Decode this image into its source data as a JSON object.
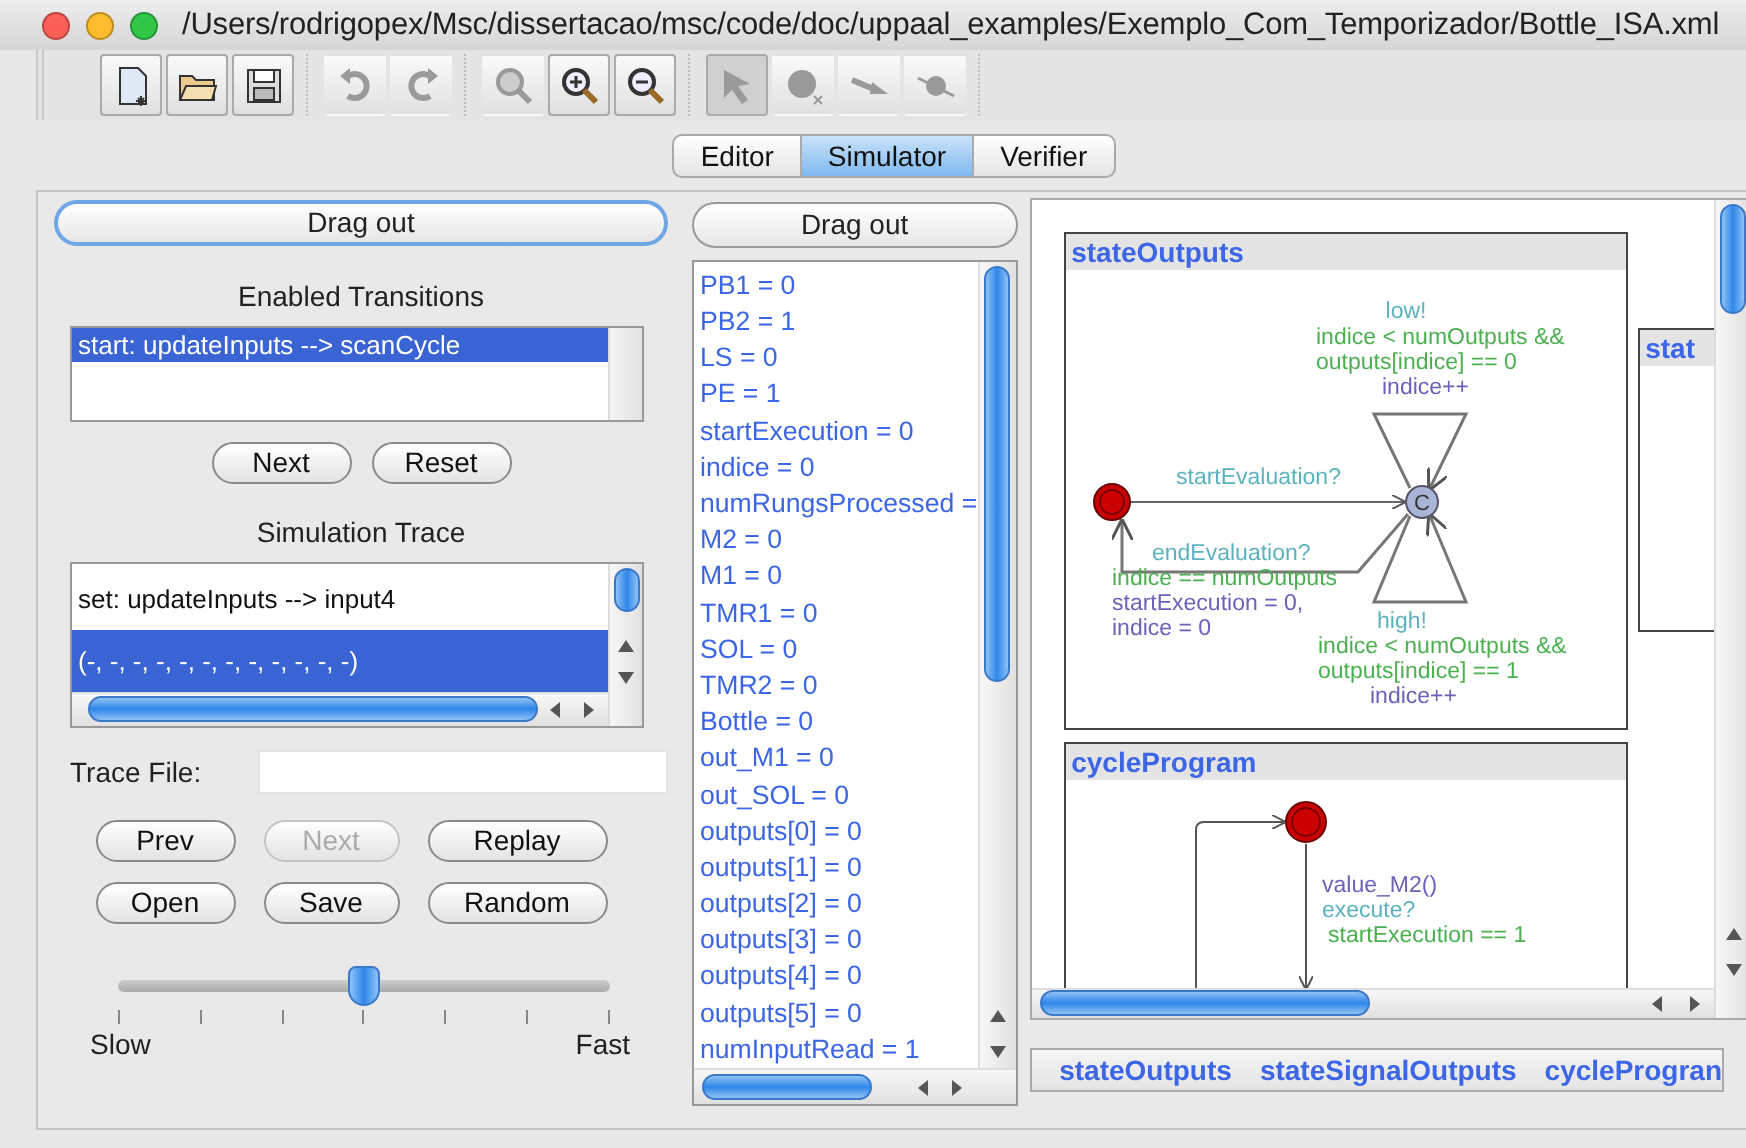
{
  "window": {
    "title": "/Users/rodrigopex/Msc/dissertacao/msc/code/doc/uppaal_examples/Exemplo_Com_Temporizador/Bottle_ISA.xml"
  },
  "toolbar": [
    [
      {
        "kind": "new",
        "disabled": false,
        "selected": false
      },
      {
        "kind": "open",
        "disabled": false,
        "selected": false
      },
      {
        "kind": "save",
        "disabled": false,
        "selected": false
      }
    ],
    [
      {
        "kind": "undo",
        "disabled": true,
        "selected": false
      },
      {
        "kind": "redo",
        "disabled": true,
        "selected": false
      }
    ],
    [
      {
        "kind": "zoom-fit",
        "disabled": true,
        "selected": false
      },
      {
        "kind": "zoom-in",
        "disabled": false,
        "selected": false
      },
      {
        "kind": "zoom-out",
        "disabled": false,
        "selected": false
      }
    ],
    [
      {
        "kind": "select",
        "disabled": true,
        "selected": true
      },
      {
        "kind": "location",
        "disabled": true,
        "selected": false
      },
      {
        "kind": "edge",
        "disabled": true,
        "selected": false
      },
      {
        "kind": "nail",
        "disabled": true,
        "selected": false
      }
    ]
  ],
  "tabs": [
    {
      "label": "Editor",
      "selected": false
    },
    {
      "label": "Simulator",
      "selected": true
    },
    {
      "label": "Verifier",
      "selected": false
    }
  ],
  "simulation": {
    "drag_out": "Drag out",
    "enabled_transitions": {
      "title": "Enabled Transitions",
      "items": [
        {
          "text": "start: updateInputs --> scanCycle",
          "selected": true
        }
      ]
    },
    "transition_buttons": [
      "Next",
      "Reset"
    ],
    "trace": {
      "title": "Simulation Trace",
      "items": [
        {
          "text": "set: updateInputs --> input4",
          "selected": false
        },
        {
          "text": "(-, -, -, -, -, -, -, -, -, -, -, -)",
          "selected": true
        }
      ]
    },
    "trace_file": {
      "label": "Trace File:"
    },
    "trace_buttons": [
      {
        "label": "Prev",
        "disabled": false
      },
      {
        "label": "Next",
        "disabled": true
      },
      {
        "label": "Replay",
        "disabled": false
      },
      {
        "label": "Open",
        "disabled": false
      },
      {
        "label": "Save",
        "disabled": false
      },
      {
        "label": "Random",
        "disabled": false
      }
    ],
    "speed": {
      "level": 0.5,
      "min_label": "Slow",
      "max_label": "Fast"
    }
  },
  "variables": {
    "drag_out": "Drag out",
    "items": [
      "PB1 = 0",
      "PB2 = 1",
      "LS = 0",
      "PE = 1",
      "startExecution = 0",
      "indice = 0",
      "numRungsProcessed =",
      "M2 = 0",
      "M1 = 0",
      "TMR1 = 0",
      "SOL = 0",
      "TMR2 = 0",
      "Bottle = 0",
      "out_M1 = 0",
      "out_SOL = 0",
      "outputs[0] = 0",
      "outputs[1] = 0",
      "outputs[2] = 0",
      "outputs[3] = 0",
      "outputs[4] = 0",
      "outputs[5] = 0",
      "numInputRead = 1"
    ]
  },
  "processes": [
    {
      "name": "stateOutputs",
      "locations": [
        {
          "kind": "initial"
        },
        {
          "kind": "committed",
          "label": "C"
        }
      ],
      "edges": [
        {
          "sync": "low!",
          "guard": [
            "indice < numOutputs  &&",
            "outputs[indice] == 0"
          ],
          "update": [
            "indice++"
          ]
        },
        {
          "sync": "startEvaluation?"
        },
        {
          "sync": "endEvaluation?",
          "guard": [
            "indice == numOutputs"
          ],
          "update": [
            "startExecution = 0,",
            "indice = 0"
          ]
        },
        {
          "sync": "high!",
          "guard": [
            "indice < numOutputs  &&",
            "outputs[indice] == 1"
          ],
          "update": [
            "indice++"
          ]
        }
      ]
    },
    {
      "name": "stat"
    },
    {
      "name": "cycleProgram",
      "locations": [
        {
          "kind": "initial"
        }
      ],
      "edges": [
        {
          "update": [
            "value_M2()"
          ],
          "sync": "execute?",
          "guard": [
            "startExecution == 1"
          ]
        }
      ]
    }
  ],
  "process_tabs": [
    "stateOutputs",
    "stateSignalOutputs",
    "cycleProgran"
  ]
}
